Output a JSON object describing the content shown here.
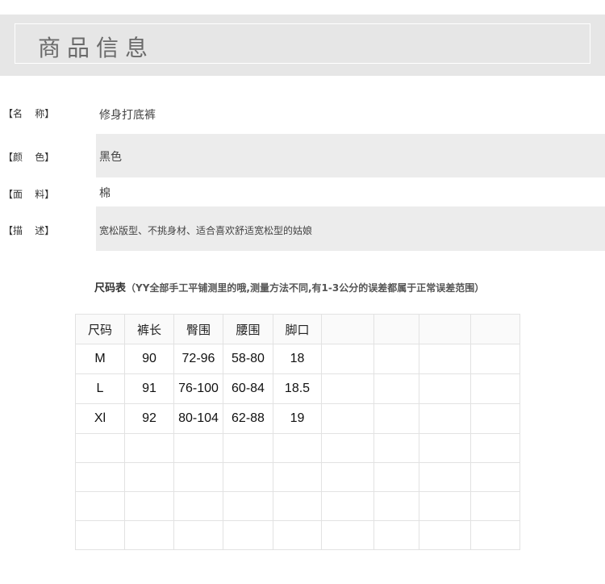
{
  "banner": {
    "title": "商品信息"
  },
  "info": [
    {
      "label": "【名    称】",
      "value": "修身打底裤"
    },
    {
      "label": "【颜    色】",
      "value": "黑色"
    },
    {
      "label": "【面    料】",
      "value": "棉"
    },
    {
      "label": "【描    述】",
      "value": "宽松版型、不挑身材、适合喜欢舒适宽松型的姑娘"
    }
  ],
  "size_chart": {
    "title": "尺码表",
    "note": "（YY全部手工平铺测里的哦,测量方法不同,有1-3公分的误差都属于正常误差范围）",
    "headers": [
      "尺码",
      "裤长",
      "臀围",
      "腰围",
      "脚口"
    ],
    "rows": [
      [
        "M",
        "90",
        "72-96",
        "58-80",
        "18"
      ],
      [
        "L",
        "91",
        "76-100",
        "60-84",
        "18.5"
      ],
      [
        "Xl",
        "92",
        "80-104",
        "62-88",
        "19"
      ]
    ]
  }
}
